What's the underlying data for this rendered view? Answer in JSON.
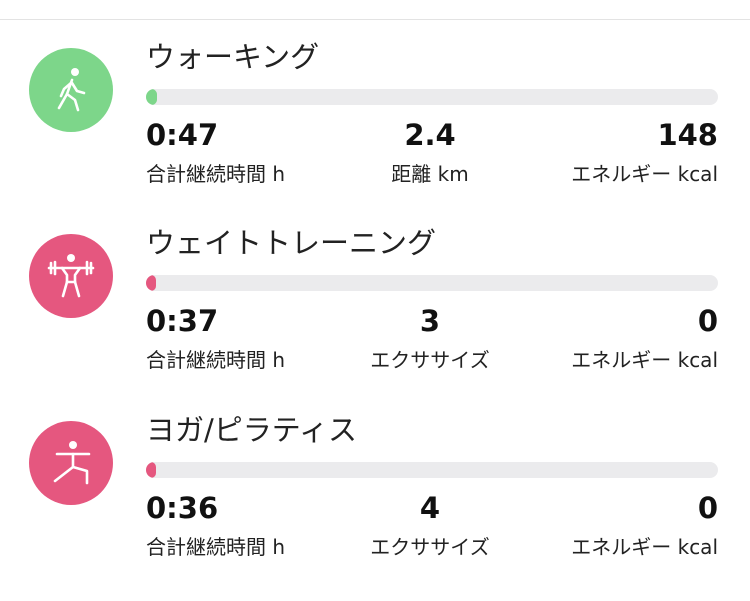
{
  "colors": {
    "walking": "#7dd68a",
    "weight": "#e5577f",
    "yoga": "#e5577f",
    "track": "#ebebed"
  },
  "activities": [
    {
      "name": "ウォーキング",
      "icon": "walking-person-icon",
      "progress": 0.02,
      "stats": [
        {
          "value": "0:47",
          "label": "合計継続時間 h"
        },
        {
          "value": "2.4",
          "label": "距離 km"
        },
        {
          "value": "148",
          "label": "エネルギー kcal"
        }
      ]
    },
    {
      "name": "ウェイトトレーニング",
      "icon": "weightlifting-icon",
      "progress": 0.01,
      "stats": [
        {
          "value": "0:37",
          "label": "合計継続時間 h"
        },
        {
          "value": "3",
          "label": "エクササイズ"
        },
        {
          "value": "0",
          "label": "エネルギー kcal"
        }
      ]
    },
    {
      "name": "ヨガ/ピラティス",
      "icon": "yoga-pose-icon",
      "progress": 0.01,
      "stats": [
        {
          "value": "0:36",
          "label": "合計継続時間 h"
        },
        {
          "value": "4",
          "label": "エクササイズ"
        },
        {
          "value": "0",
          "label": "エネルギー kcal"
        }
      ]
    }
  ]
}
